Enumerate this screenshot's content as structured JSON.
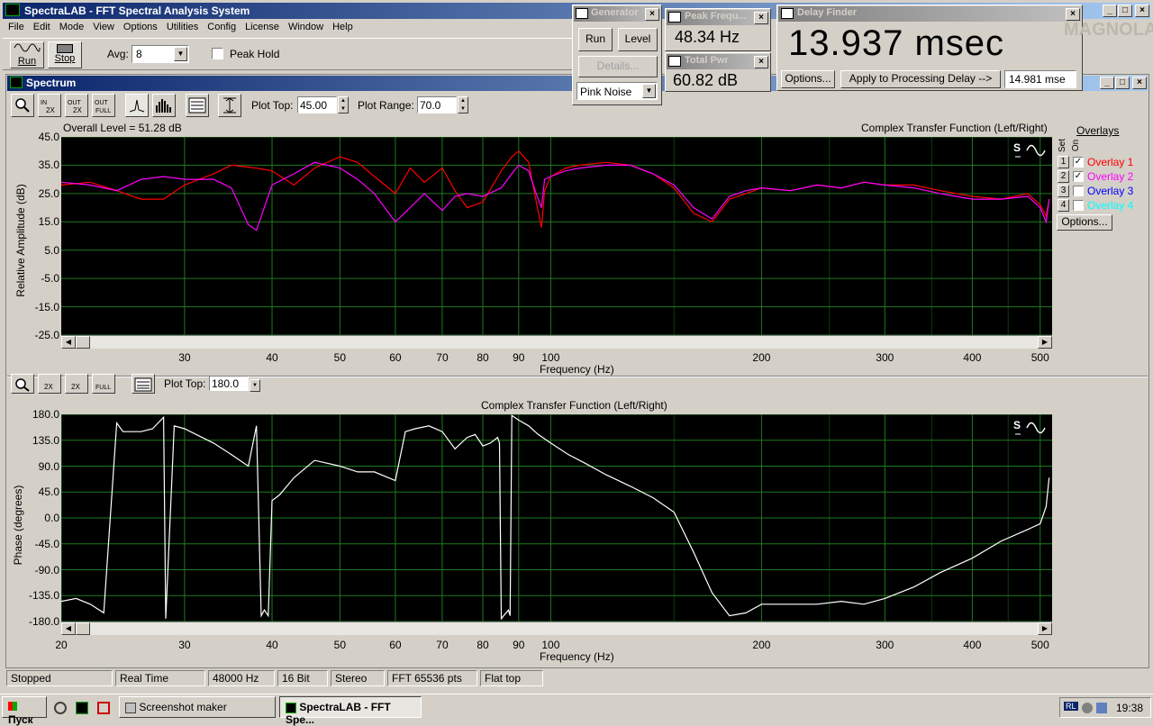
{
  "app": {
    "title": "SpectraLAB - FFT Spectral Analysis System",
    "menu": [
      "File",
      "Edit",
      "Mode",
      "View",
      "Options",
      "Utilities",
      "Config",
      "License",
      "Window",
      "Help"
    ]
  },
  "toolbar": {
    "run_label": "Run",
    "stop_label": "Stop",
    "avg_label": "Avg:",
    "avg_value": "8",
    "peak_hold_label": "Peak Hold"
  },
  "generator": {
    "title": "Generator",
    "run_label": "Run",
    "level_label": "Level",
    "details_label": "Details...",
    "noise_type": "Pink Noise"
  },
  "peak_freq": {
    "title": "Peak Frequ...",
    "value": "48.34 Hz"
  },
  "total_pwr": {
    "title": "Total Pwr",
    "value": "60.82 dB"
  },
  "delay_finder": {
    "title": "Delay Finder",
    "value": "13.937 msec",
    "options_label": "Options...",
    "apply_label": "Apply to Processing Delay -->",
    "processing_delay": "14.981 mse",
    "watermark": "MAGNOLA"
  },
  "spectrum": {
    "window_title": "Spectrum",
    "plot_top_label": "Plot Top:",
    "plot_top_value": "45.00",
    "plot_range_label": "Plot Range:",
    "plot_range_value": "70.0",
    "overall_level": "Overall Level = 51.28 dB",
    "upper_title": "Complex Transfer Function (Left/Right)",
    "lower_plot_top_label": "Plot Top:",
    "lower_plot_top_value": "180.0",
    "lower_title": "Complex Transfer Function (Left/Right)"
  },
  "overlays": {
    "header": "Overlays",
    "set_label": "Set",
    "on_label": "On",
    "items": [
      {
        "num": "1",
        "label": "Overlay 1",
        "checked": true,
        "color": "#ff0000"
      },
      {
        "num": "2",
        "label": "Overlay 2",
        "checked": true,
        "color": "#ff00ff"
      },
      {
        "num": "3",
        "label": "Overlay 3",
        "checked": false,
        "color": "#0000ff"
      },
      {
        "num": "4",
        "label": "Overlay 4",
        "checked": false,
        "color": "#00ffff"
      }
    ],
    "options_label": "Options..."
  },
  "chart_data": [
    {
      "type": "line",
      "ylabel": "Relative Amplitude (dB)",
      "xlabel": "Frequency (Hz)",
      "x_scale": "log",
      "xlim": [
        20,
        520
      ],
      "ylim": [
        -25,
        45
      ],
      "yticks": [
        "45.0",
        "35.0",
        "25.0",
        "15.0",
        "5.0",
        "-5.0",
        "-15.0",
        "-25.0"
      ],
      "xticks": [
        "30",
        "40",
        "50",
        "60",
        "70",
        "80",
        "90",
        "100",
        "200",
        "300",
        "400",
        "500"
      ],
      "grid": true,
      "series": [
        {
          "name": "Overlay 1",
          "color": "#ff0000",
          "x": [
            20,
            22,
            24,
            26,
            28,
            30,
            33,
            35,
            38,
            40,
            43,
            46,
            50,
            53,
            56,
            60,
            63,
            66,
            70,
            73,
            76,
            80,
            85,
            88,
            90,
            93,
            95,
            97,
            98,
            100,
            105,
            110,
            120,
            130,
            140,
            150,
            160,
            170,
            180,
            190,
            200,
            220,
            240,
            260,
            280,
            300,
            330,
            360,
            400,
            440,
            480,
            500,
            510,
            515
          ],
          "y": [
            28,
            29,
            26,
            23,
            23,
            28,
            32,
            35,
            34,
            33,
            28,
            34,
            38,
            36,
            31,
            25,
            34,
            29,
            34,
            26,
            20,
            22,
            33,
            38,
            40,
            36,
            24,
            13,
            26,
            31,
            34,
            35,
            36,
            35,
            32,
            27,
            18,
            15,
            23,
            25,
            27,
            26,
            28,
            27,
            29,
            28,
            28,
            26,
            24,
            23,
            25,
            21,
            17,
            23
          ]
        },
        {
          "name": "Overlay 2",
          "color": "#ff00ff",
          "x": [
            20,
            22,
            24,
            26,
            28,
            30,
            33,
            35,
            37,
            38,
            40,
            43,
            46,
            50,
            53,
            56,
            60,
            63,
            66,
            70,
            73,
            76,
            80,
            85,
            88,
            90,
            93,
            95,
            97,
            98,
            100,
            105,
            110,
            120,
            130,
            140,
            150,
            160,
            170,
            180,
            190,
            200,
            220,
            240,
            260,
            280,
            300,
            330,
            360,
            400,
            440,
            480,
            500,
            510,
            515
          ],
          "y": [
            29,
            28,
            26,
            30,
            31,
            30,
            30,
            27,
            14,
            12,
            28,
            32,
            36,
            34,
            30,
            25,
            15,
            20,
            25,
            19,
            24,
            25,
            24,
            27,
            32,
            35,
            33,
            26,
            20,
            30,
            31,
            33,
            34,
            35,
            35,
            32,
            28,
            20,
            16,
            24,
            26,
            27,
            26,
            28,
            27,
            29,
            28,
            27,
            25,
            23,
            23,
            24,
            20,
            15,
            23
          ]
        }
      ]
    },
    {
      "type": "line",
      "ylabel": "Phase (degrees)",
      "xlabel": "Frequency (Hz)",
      "x_scale": "log",
      "xlim": [
        20,
        520
      ],
      "ylim": [
        -180,
        180
      ],
      "yticks": [
        "180.0",
        "135.0",
        "90.0",
        "45.0",
        "0.0",
        "-45.0",
        "-90.0",
        "-135.0",
        "-180.0"
      ],
      "xticks": [
        "20",
        "30",
        "40",
        "50",
        "60",
        "70",
        "80",
        "90",
        "100",
        "200",
        "300",
        "400",
        "500"
      ],
      "grid": true,
      "series": [
        {
          "name": "",
          "color": "#ffffff",
          "x": [
            20,
            21,
            22,
            23,
            24,
            24.5,
            26,
            27,
            28,
            28.2,
            29,
            30,
            33,
            35,
            37,
            38,
            38.6,
            39,
            39.5,
            40,
            41,
            43,
            46,
            50,
            53,
            56,
            60,
            62,
            64,
            67,
            70,
            73,
            76,
            78,
            80,
            82,
            84,
            84.5,
            85,
            87,
            87.5,
            88,
            90,
            93,
            96,
            100,
            106,
            112,
            120,
            130,
            140,
            150,
            160,
            170,
            180,
            190,
            200,
            220,
            240,
            260,
            280,
            300,
            330,
            360,
            400,
            440,
            480,
            500,
            510,
            515
          ],
          "y": [
            -145,
            -140,
            -150,
            -165,
            165,
            150,
            150,
            155,
            175,
            -175,
            160,
            155,
            130,
            110,
            90,
            160,
            -170,
            -160,
            -170,
            30,
            40,
            70,
            100,
            90,
            80,
            80,
            65,
            150,
            155,
            160,
            150,
            120,
            140,
            145,
            125,
            130,
            140,
            130,
            -175,
            -160,
            -170,
            178,
            170,
            160,
            145,
            130,
            110,
            95,
            75,
            55,
            35,
            10,
            -60,
            -130,
            -170,
            -165,
            -150,
            -150,
            -150,
            -145,
            -150,
            -140,
            -120,
            -95,
            -70,
            -40,
            -20,
            -10,
            20,
            70
          ]
        }
      ]
    }
  ],
  "status_bar": [
    "Stopped",
    "Real Time",
    "48000 Hz",
    "16 Bit",
    "Stereo",
    "FFT 65536 pts",
    "Flat top"
  ],
  "taskbar": {
    "start_label": "Пуск",
    "tasks": [
      "Screenshot maker",
      "SpectraLAB - FFT Spe..."
    ],
    "lang": "RL",
    "clock": "19:38"
  }
}
